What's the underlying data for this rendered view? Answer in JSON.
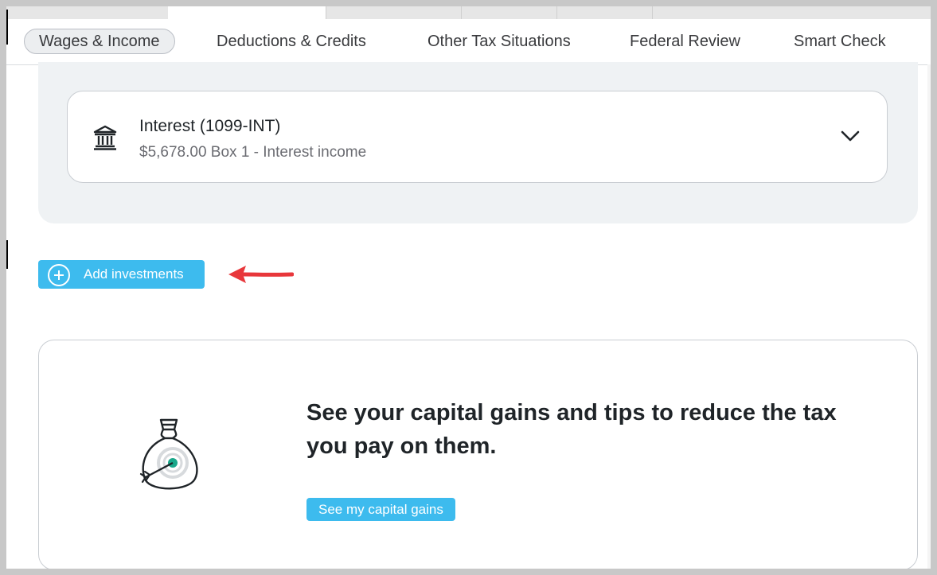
{
  "nav": {
    "items": [
      {
        "label": "Wages & Income",
        "active": true
      },
      {
        "label": "Deductions & Credits",
        "active": false
      },
      {
        "label": "Other Tax Situations",
        "active": false
      },
      {
        "label": "Federal Review",
        "active": false
      },
      {
        "label": "Smart Check",
        "active": false
      }
    ]
  },
  "income_card": {
    "icon": "bank-icon",
    "title": "Interest (1099-INT)",
    "subtitle": "$5,678.00 Box 1 - Interest income"
  },
  "add_button": {
    "label": "Add investments",
    "icon": "plus-circle-icon"
  },
  "promo": {
    "icon": "money-bag-target-icon",
    "heading": "See your capital gains and tips to reduce the tax you pay on them.",
    "button_label": "See my capital gains"
  },
  "colors": {
    "accent": "#3dbbee",
    "annotation_arrow": "#e8373b",
    "panel_bg": "#eff2f4",
    "target_green": "#1aa88b"
  }
}
